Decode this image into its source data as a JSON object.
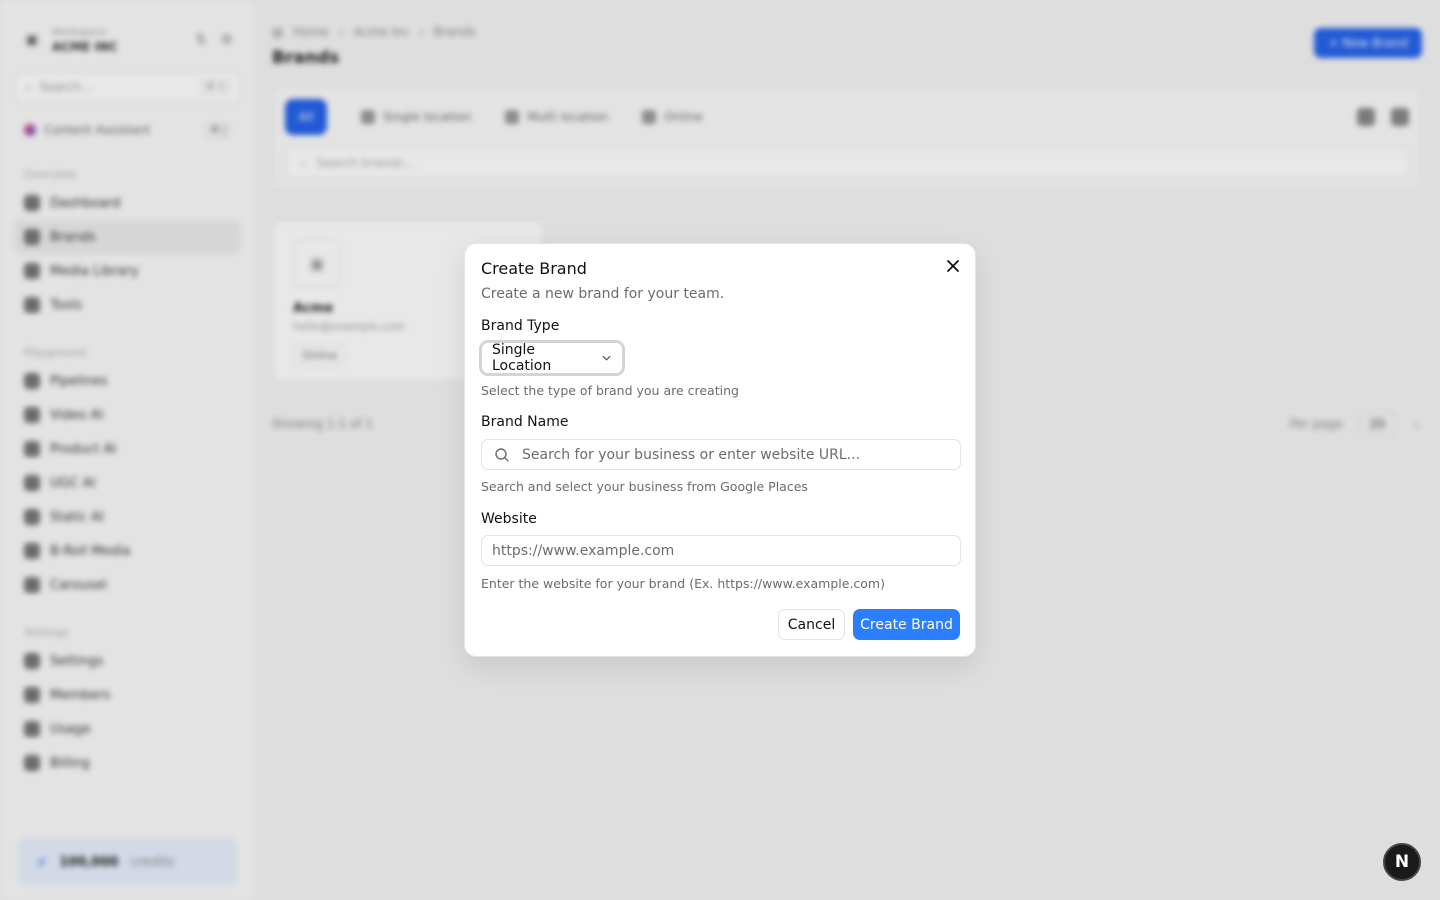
{
  "sidebar": {
    "workspace_sub": "Workspace",
    "workspace_name": "ACME INC",
    "search_placeholder": "Search...",
    "search_kbd": "⌘ K",
    "promo_label": "Content Assistant",
    "promo_kbd": "⌘ J",
    "groups": [
      {
        "title": "Overview",
        "items": [
          {
            "label": "Dashboard",
            "active": false
          },
          {
            "label": "Brands",
            "active": true
          },
          {
            "label": "Media Library",
            "active": false
          },
          {
            "label": "Tools",
            "active": false
          }
        ]
      },
      {
        "title": "Playground",
        "items": [
          {
            "label": "Pipelines",
            "active": false
          },
          {
            "label": "Video AI",
            "active": false
          },
          {
            "label": "Product AI",
            "active": false
          },
          {
            "label": "UGC AI",
            "active": false
          },
          {
            "label": "Static AI",
            "active": false
          },
          {
            "label": "B-Roll Media",
            "active": false
          },
          {
            "label": "Carousel",
            "active": false
          }
        ]
      },
      {
        "title": "Settings",
        "items": [
          {
            "label": "Settings",
            "active": false
          },
          {
            "label": "Members",
            "active": false
          },
          {
            "label": "Usage",
            "active": false
          },
          {
            "label": "Billing",
            "active": false
          }
        ]
      }
    ],
    "credits_value": "100,000",
    "credits_unit": "credits"
  },
  "main": {
    "breadcrumbs": [
      "Home",
      "Acme Inc",
      "Brands"
    ],
    "title": "Brands",
    "new_brand_label": "+ New Brand",
    "tabs": [
      "All",
      "Single location",
      "Multi location",
      "Online"
    ],
    "search_placeholder": "Search brands...",
    "brand_card": {
      "name": "Acme",
      "email": "hello@example.com",
      "badge": "Online"
    },
    "showing": "Showing 1-1 of 1",
    "per_page_label": "Per page",
    "per_page_value": "20"
  },
  "dialog": {
    "title": "Create Brand",
    "description": "Create a new brand for your team.",
    "brand_type_label": "Brand Type",
    "brand_type_value": "Single Location",
    "brand_type_help": "Select the type of brand you are creating",
    "brand_name_label": "Brand Name",
    "brand_name_placeholder": "Search for your business or enter website URL...",
    "brand_name_help": "Search and select your business from Google Places",
    "website_label": "Website",
    "website_placeholder": "https://www.example.com",
    "website_help": "Enter the website for your brand (Ex. https://www.example.com)",
    "cancel_label": "Cancel",
    "create_label": "Create Brand"
  },
  "badge": {
    "letter": "N"
  },
  "colors": {
    "accent": "#2b7fff",
    "overlay": "rgba(0,0,0,0.09)"
  }
}
